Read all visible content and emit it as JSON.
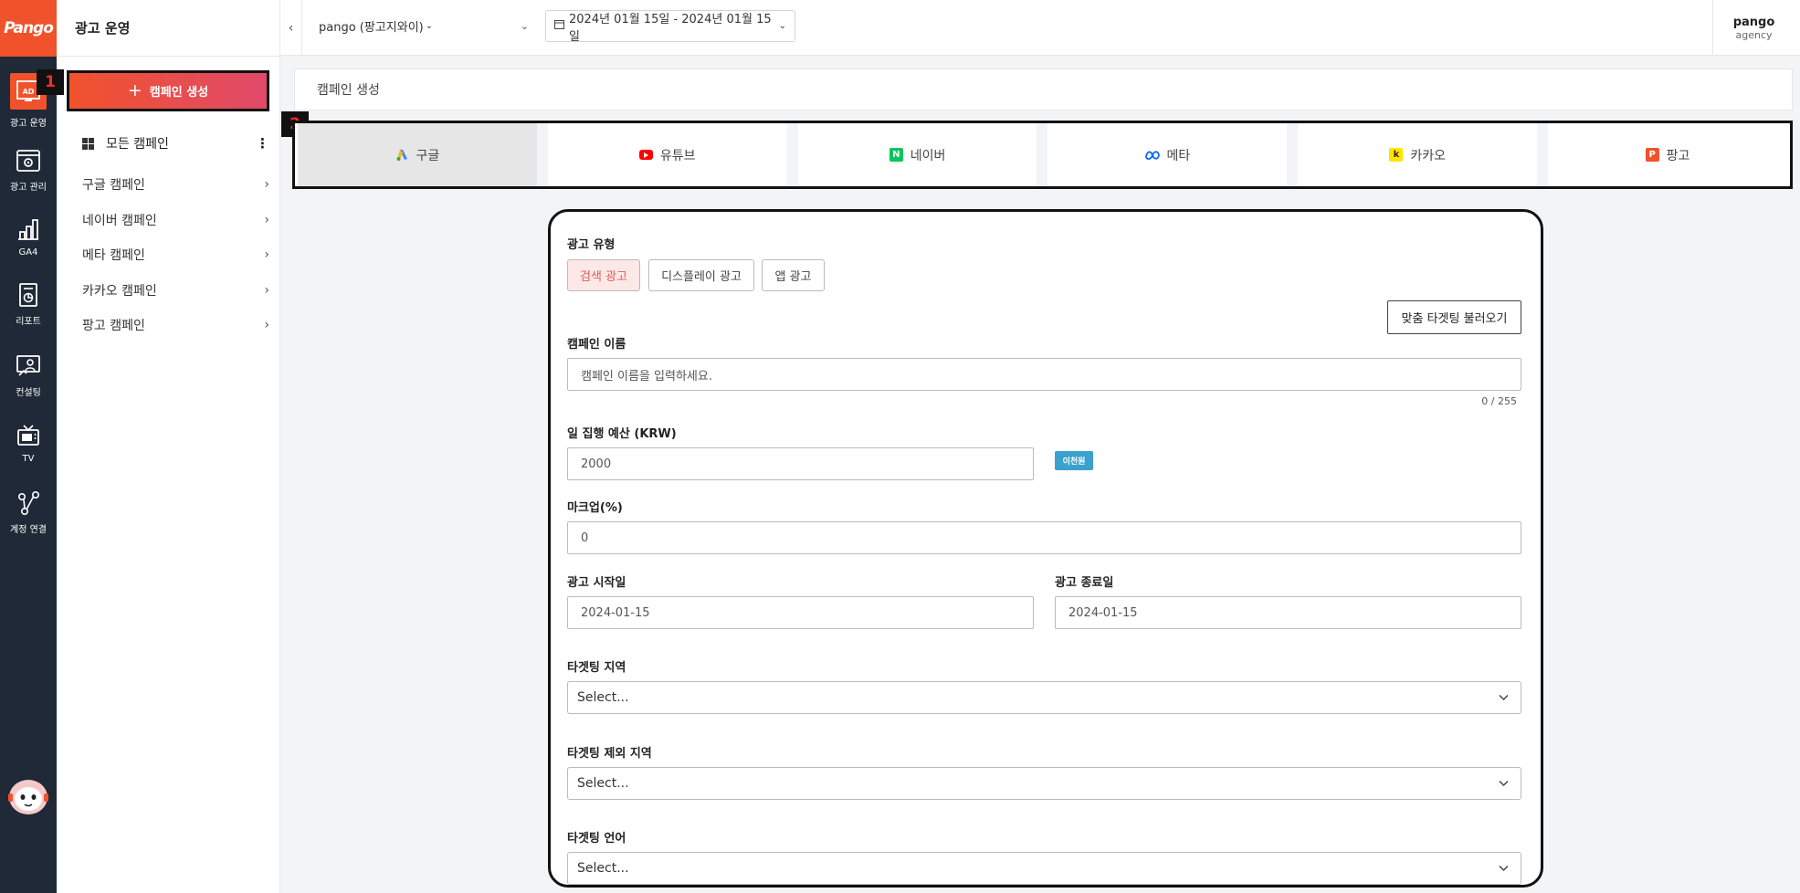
{
  "rail": {
    "logo": "Pango",
    "items": [
      {
        "label": "광고 운영",
        "icon": "ad-icon"
      },
      {
        "label": "광고 관리",
        "icon": "gear-box-icon"
      },
      {
        "label": "GA4",
        "icon": "bar-chart-icon"
      },
      {
        "label": "리포트",
        "icon": "report-icon"
      },
      {
        "label": "컨설팅",
        "icon": "consulting-icon"
      },
      {
        "label": "TV",
        "icon": "tv-icon"
      },
      {
        "label": "계정 연결",
        "icon": "connect-icon"
      }
    ],
    "assistant_icon": "chatbot-avatar-icon"
  },
  "nav": {
    "title": "광고 운영",
    "create_button": "캠페인 생성",
    "all_campaigns": "모든 캠페인",
    "items": [
      "구글 캠페인",
      "네이버 캠페인",
      "메타 캠페인",
      "카카오 캠페인",
      "팡고 캠페인"
    ]
  },
  "markers": {
    "one": "1",
    "two": "2"
  },
  "header": {
    "account": "pango (팡고지와이)",
    "date_range": "2024년 01월 15일 - 2024년 01월 15일",
    "user_name": "pango",
    "user_role": "agency"
  },
  "page_title": "캠페인 생성",
  "tabs": [
    {
      "label": "구글",
      "icon": "google-ads-icon",
      "color": "#4285f4"
    },
    {
      "label": "유튜브",
      "icon": "youtube-icon",
      "color": "#ff0000"
    },
    {
      "label": "네이버",
      "icon": "naver-icon",
      "color": "#03c75a"
    },
    {
      "label": "메타",
      "icon": "meta-icon",
      "color": "#0866ff"
    },
    {
      "label": "카카오",
      "icon": "kakao-icon",
      "color": "#fee500"
    },
    {
      "label": "팡고",
      "icon": "pango-icon",
      "color": "#f0522c"
    }
  ],
  "form": {
    "ad_type_label": "광고 유형",
    "ad_types": [
      "검색 광고",
      "디스플레이 광고",
      "앱 광고"
    ],
    "load_targeting_button": "맞춤 타겟팅 불러오기",
    "campaign_name_label": "캠페인 이름",
    "campaign_name_placeholder": "캠페인 이름을 입력하세요.",
    "campaign_name_counter": "0 / 255",
    "daily_budget_label": "일 집행 예산 (KRW)",
    "daily_budget_value": "2000",
    "budget_chip": "이천원",
    "markup_label": "마크업(%)",
    "markup_value": "0",
    "start_date_label": "광고 시작일",
    "start_date_value": "2024-01-15",
    "end_date_label": "광고 종료일",
    "end_date_value": "2024-01-15",
    "target_region_label": "타겟팅 지역",
    "target_region_value": "Select...",
    "excluded_region_label": "타겟팅 제외 지역",
    "excluded_region_value": "Select...",
    "target_language_label": "타겟팅 언어",
    "target_language_value": "Select..."
  },
  "colors": {
    "brand": "#f0522c",
    "rail_bg": "#1f2937",
    "chip": "#3aa1cf",
    "active_segment_bg": "#fde8e8"
  }
}
